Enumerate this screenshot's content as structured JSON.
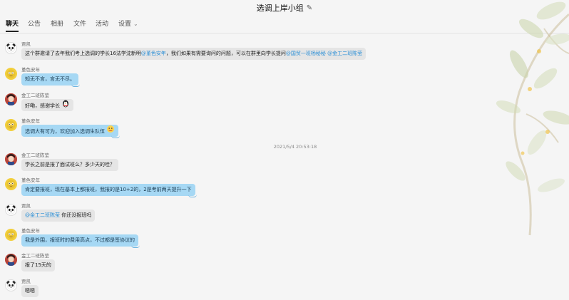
{
  "window": {
    "title": "选调上岸小组"
  },
  "tabs": [
    {
      "label": "聊天"
    },
    {
      "label": "公告"
    },
    {
      "label": "相册"
    },
    {
      "label": "文件"
    },
    {
      "label": "活动"
    },
    {
      "label": "设置"
    }
  ],
  "timestamp": "2021/5/4 20:53:18",
  "messages": [
    {
      "sender": "贾凯",
      "parts": [
        "这个群邀请了去年我们考上选调的学长16法学沈新明",
        "@堇色安年",
        "，我们如果有需要询问的问题，可以在群里向学长提问",
        "@国贸一班杨秘秘",
        " ",
        "@金工二班陈莹"
      ]
    },
    {
      "sender": "堇色安年",
      "text": "知无不言，言无不尽。"
    },
    {
      "sender": "金工二班陈莹",
      "text": "好嘞，感谢学长"
    },
    {
      "sender": "堇色安年",
      "text": "选调大有可为，欢迎加入选调生队伍"
    },
    {
      "sender": "金工二班陈莹",
      "text": "学长之前是报了面试班么？多少天的哇？"
    },
    {
      "sender": "堇色安年",
      "text": "肯定要报班，现在基本上都报班，我报的是10+2的，2是考前两天提升一下"
    },
    {
      "sender": "贾凯",
      "mention": "@金工二班陈莹",
      "text": " 你还没报班吗"
    },
    {
      "sender": "堇色安年",
      "text": "我是外围，报班时的费用高点，不过都是签协议的"
    },
    {
      "sender": "金工二班陈莹",
      "text": "报了15天的"
    },
    {
      "sender": "贾凯",
      "text": "嗯嗯"
    }
  ],
  "icons": {
    "edit": "pencil-icon",
    "settings_chevron": "chevron-down-icon",
    "emoji_penguin": "penguin-emoji-icon",
    "emoji_face": "face-emoji-icon"
  },
  "colors": {
    "bubble_gray": "#e5e5e5",
    "bubble_blue": "#a6d8f4",
    "mention": "#2b8fd6"
  }
}
